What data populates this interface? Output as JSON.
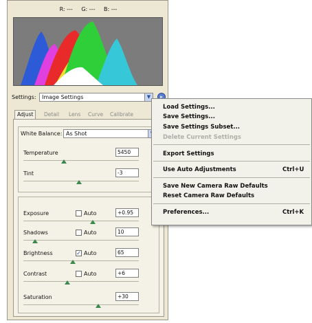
{
  "rgb": {
    "r": "R: ---",
    "g": "G: ---",
    "b": "B: ---"
  },
  "settings": {
    "label": "Settings:",
    "value": "Image Settings",
    "menu_icon": "menu-arrow-icon"
  },
  "tabs": [
    "Adjust",
    "Detail",
    "Lens",
    "Curve",
    "Calibrate"
  ],
  "white_balance": {
    "label": "White Balance:",
    "value": "As Shot"
  },
  "sliders": [
    {
      "label": "Temperature",
      "value": "5450",
      "level": 0.35
    },
    {
      "label": "Tint",
      "value": "-3",
      "level": 0.48
    },
    {
      "label": "Exposure",
      "auto_label": "Auto",
      "auto": false,
      "value": "+0.95",
      "level": 0.6
    },
    {
      "label": "Shadows",
      "auto_label": "Auto",
      "auto": false,
      "value": "10",
      "level": 0.1
    },
    {
      "label": "Brightness",
      "auto_label": "Auto",
      "auto": true,
      "value": "65",
      "level": 0.43
    },
    {
      "label": "Contrast",
      "auto_label": "Auto",
      "auto": false,
      "value": "+6",
      "level": 0.38
    },
    {
      "label": "Saturation",
      "value": "+30",
      "level": 0.65
    }
  ],
  "menu": {
    "items": [
      {
        "label": "Load Settings...",
        "shortcut": "",
        "disabled": false
      },
      {
        "label": "Save Settings...",
        "shortcut": "",
        "disabled": false
      },
      {
        "label": "Save Settings Subset...",
        "shortcut": "",
        "disabled": false
      },
      {
        "label": "Delete Current Settings",
        "shortcut": "",
        "disabled": true
      },
      {
        "label": "Export Settings",
        "shortcut": "",
        "disabled": false
      },
      {
        "label": "Use Auto Adjustments",
        "shortcut": "Ctrl+U",
        "disabled": false
      },
      {
        "label": "Save New Camera Raw Defaults",
        "shortcut": "",
        "disabled": false
      },
      {
        "label": "Reset Camera Raw Defaults",
        "shortcut": "",
        "disabled": false
      },
      {
        "label": "Preferences...",
        "shortcut": "Ctrl+K",
        "disabled": false
      }
    ]
  },
  "colors": {
    "panel_bg": "#ece8d4",
    "histogram_bg": "#7c7c7c",
    "accent": "#5a7fd0",
    "slider_thumb": "#39884c"
  }
}
